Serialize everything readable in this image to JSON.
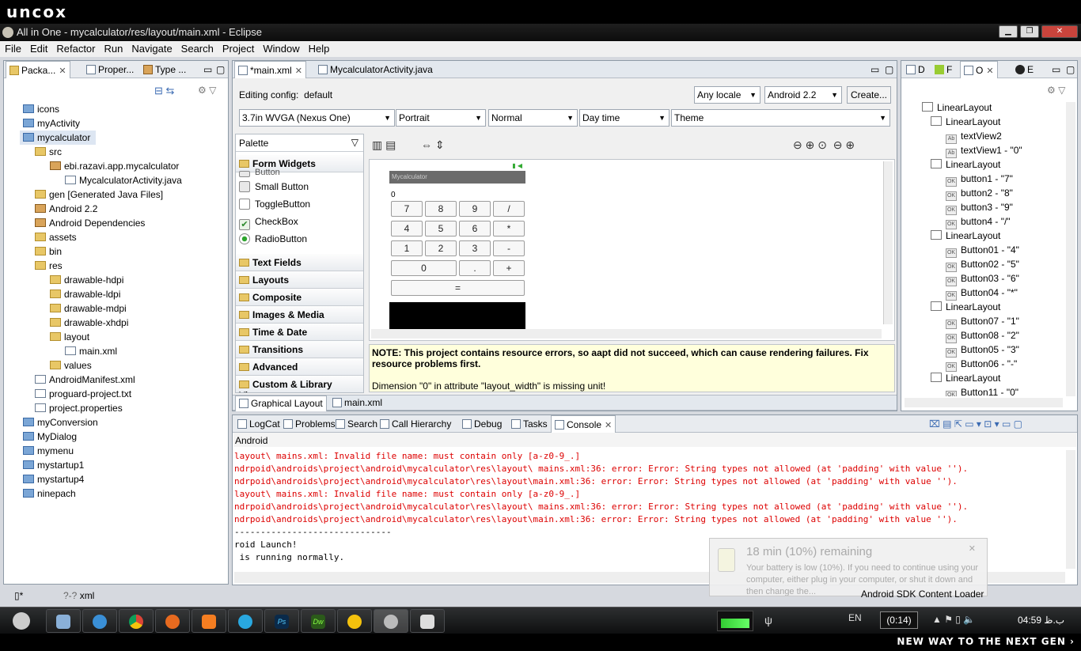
{
  "watermark": {
    "logo": "uncox",
    "slogan": "NEW WAY TO THE NEXT GEN ›"
  },
  "window": {
    "title": "All in One - mycalculator/res/layout/main.xml - Eclipse"
  },
  "menu": [
    "File",
    "Edit",
    "Refactor",
    "Run",
    "Navigate",
    "Search",
    "Project",
    "Window",
    "Help"
  ],
  "left_tabs": [
    "Packa...",
    "Proper...",
    "Type ..."
  ],
  "project_tree": [
    {
      "label": "icons",
      "type": "proj",
      "depth": 0
    },
    {
      "label": "myActivity",
      "type": "proj",
      "depth": 0
    },
    {
      "label": "mycalculator",
      "type": "proj",
      "depth": 0
    },
    {
      "label": "src",
      "type": "fold",
      "depth": 1
    },
    {
      "label": "ebi.razavi.app.mycalculator",
      "type": "pkg",
      "depth": 2
    },
    {
      "label": "MycalculatorActivity.java",
      "type": "file",
      "depth": 3
    },
    {
      "label": "gen [Generated Java Files]",
      "type": "fold",
      "depth": 1
    },
    {
      "label": "Android 2.2",
      "type": "pkg",
      "depth": 1
    },
    {
      "label": "Android Dependencies",
      "type": "pkg",
      "depth": 1
    },
    {
      "label": "assets",
      "type": "fold",
      "depth": 1
    },
    {
      "label": "bin",
      "type": "fold",
      "depth": 1
    },
    {
      "label": "res",
      "type": "fold",
      "depth": 1
    },
    {
      "label": "drawable-hdpi",
      "type": "fold",
      "depth": 2
    },
    {
      "label": "drawable-ldpi",
      "type": "fold",
      "depth": 2
    },
    {
      "label": "drawable-mdpi",
      "type": "fold",
      "depth": 2
    },
    {
      "label": "drawable-xhdpi",
      "type": "fold",
      "depth": 2
    },
    {
      "label": "layout",
      "type": "fold",
      "depth": 2
    },
    {
      "label": "main.xml",
      "type": "file",
      "depth": 3
    },
    {
      "label": "values",
      "type": "fold",
      "depth": 2
    },
    {
      "label": "AndroidManifest.xml",
      "type": "file",
      "depth": 1
    },
    {
      "label": "proguard-project.txt",
      "type": "file",
      "depth": 1
    },
    {
      "label": "project.properties",
      "type": "file",
      "depth": 1
    },
    {
      "label": "myConversion",
      "type": "proj",
      "depth": 0
    },
    {
      "label": "MyDialog",
      "type": "proj",
      "depth": 0
    },
    {
      "label": "mymenu",
      "type": "proj",
      "depth": 0
    },
    {
      "label": "mystartup1",
      "type": "proj",
      "depth": 0
    },
    {
      "label": "mystartup4",
      "type": "proj",
      "depth": 0
    },
    {
      "label": "ninepach",
      "type": "proj",
      "depth": 0
    }
  ],
  "editor": {
    "tabs": [
      "*main.xml",
      "MycalculatorActivity.java"
    ],
    "config_label": "Editing config:",
    "config_value": "default",
    "locale": "Any locale",
    "target": "Android 2.2",
    "create": "Create...",
    "device": "3.7in WVGA (Nexus One)",
    "orientation": "Portrait",
    "mode": "Normal",
    "time": "Day time",
    "theme": "Theme",
    "palette_title": "Palette",
    "palette_sections": [
      "Form Widgets",
      "Text Fields",
      "Layouts",
      "Composite",
      "Images & Media",
      "Time & Date",
      "Transitions",
      "Advanced",
      "Custom & Library Views"
    ],
    "form_widgets": [
      "Button",
      "Small Button",
      "ToggleButton",
      "CheckBox",
      "RadioButton"
    ],
    "app_title": "Mycalculator",
    "display_value": "0",
    "calc_rows": [
      [
        "7",
        "8",
        "9",
        "/"
      ],
      [
        "4",
        "5",
        "6",
        "*"
      ],
      [
        "1",
        "2",
        "3",
        "-"
      ],
      [
        "0",
        ".",
        "+"
      ],
      [
        "="
      ]
    ],
    "note_bold": "NOTE: This project contains resource errors, so aapt did not succeed, which can cause rendering failures. Fix resource problems first.",
    "note_line": "Dimension \"0\" in attribute \"layout_width\" is missing unit!",
    "bottom_tabs": [
      "Graphical Layout",
      "main.xml"
    ]
  },
  "right_tabs": [
    "D",
    "F",
    "O",
    "E"
  ],
  "outline": [
    {
      "label": "LinearLayout",
      "kind": "layout",
      "depth": 0
    },
    {
      "label": "LinearLayout",
      "kind": "layout",
      "depth": 1
    },
    {
      "label": "textView2",
      "kind": "ab",
      "depth": 2
    },
    {
      "label": "textView1 - \"0\"",
      "kind": "ab",
      "depth": 2
    },
    {
      "label": "LinearLayout",
      "kind": "layout",
      "depth": 1
    },
    {
      "label": "button1 - \"7\"",
      "kind": "ok",
      "depth": 2
    },
    {
      "label": "button2 - \"8\"",
      "kind": "ok",
      "depth": 2
    },
    {
      "label": "button3 - \"9\"",
      "kind": "ok",
      "depth": 2
    },
    {
      "label": "button4 - \"/\"",
      "kind": "ok",
      "depth": 2
    },
    {
      "label": "LinearLayout",
      "kind": "layout",
      "depth": 1
    },
    {
      "label": "Button01 - \"4\"",
      "kind": "ok",
      "depth": 2
    },
    {
      "label": "Button02 - \"5\"",
      "kind": "ok",
      "depth": 2
    },
    {
      "label": "Button03 - \"6\"",
      "kind": "ok",
      "depth": 2
    },
    {
      "label": "Button04 - \"*\"",
      "kind": "ok",
      "depth": 2
    },
    {
      "label": "LinearLayout",
      "kind": "layout",
      "depth": 1
    },
    {
      "label": "Button07 - \"1\"",
      "kind": "ok",
      "depth": 2
    },
    {
      "label": "Button08 - \"2\"",
      "kind": "ok",
      "depth": 2
    },
    {
      "label": "Button05 - \"3\"",
      "kind": "ok",
      "depth": 2
    },
    {
      "label": "Button06 - \"-\"",
      "kind": "ok",
      "depth": 2
    },
    {
      "label": "LinearLayout",
      "kind": "layout",
      "depth": 1
    },
    {
      "label": "Button11 - \"0\"",
      "kind": "ok",
      "depth": 2
    }
  ],
  "console": {
    "tabs": [
      "LogCat",
      "Problems",
      "Search",
      "Call Hierarchy",
      "Debug",
      "Tasks",
      "Console"
    ],
    "header": "Android",
    "lines": [
      {
        "t": "layout\\ mains.xml: Invalid file name: must contain only [a-z0-9_.]",
        "red": true
      },
      {
        "t": "ndrpoid\\androids\\project\\android\\mycalculator\\res\\layout\\ mains.xml:36: error: Error: String types not allowed (at 'padding' with value '').",
        "red": true
      },
      {
        "t": "ndrpoid\\androids\\project\\android\\mycalculator\\res\\layout\\main.xml:36: error: Error: String types not allowed (at 'padding' with value '').",
        "red": true
      },
      {
        "t": "layout\\ mains.xml: Invalid file name: must contain only [a-z0-9_.]",
        "red": true
      },
      {
        "t": "ndrpoid\\androids\\project\\android\\mycalculator\\res\\layout\\ mains.xml:36: error: Error: String types not allowed (at 'padding' with value '').",
        "red": true
      },
      {
        "t": "ndrpoid\\androids\\project\\android\\mycalculator\\res\\layout\\main.xml:36: error: Error: String types not allowed (at 'padding' with value '').",
        "red": true
      },
      {
        "t": "------------------------------",
        "red": false
      },
      {
        "t": "roid Launch!",
        "red": false
      },
      {
        "t": " is running normally.",
        "red": false
      }
    ]
  },
  "battery": {
    "title": "18 min (10%) remaining",
    "text": "Your battery is low (10%). If you need to continue using your computer, either plug in your computer, or shut it down and then change the..."
  },
  "status": {
    "left": "xml",
    "loader": "Android SDK Content Loader"
  },
  "tray": {
    "lang": "EN",
    "time_box": "(0:14)",
    "clock": "04:59 ب.ظ"
  }
}
